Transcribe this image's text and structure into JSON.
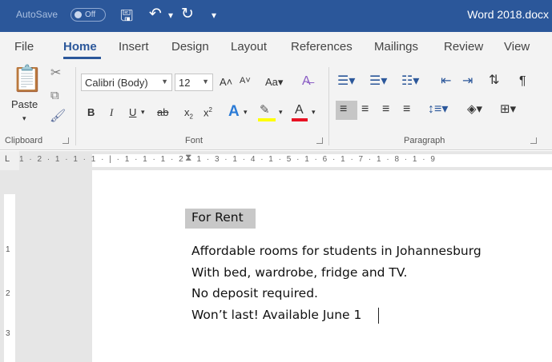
{
  "titlebar": {
    "autosave_label": "AutoSave",
    "autosave_state": "Off",
    "document_title": "Word 2018.docx"
  },
  "tabs": [
    {
      "label": "File"
    },
    {
      "label": "Home",
      "active": true
    },
    {
      "label": "Insert"
    },
    {
      "label": "Design"
    },
    {
      "label": "Layout"
    },
    {
      "label": "References"
    },
    {
      "label": "Mailings"
    },
    {
      "label": "Review"
    },
    {
      "label": "View"
    }
  ],
  "ribbon": {
    "clipboard": {
      "paste_label": "Paste",
      "group_label": "Clipboard"
    },
    "font": {
      "font_name": "Calibri (Body)",
      "font_size": "12",
      "group_label": "Font",
      "highlight_color": "#ffff00",
      "font_color": "#e81123"
    },
    "paragraph": {
      "group_label": "Paragraph"
    }
  },
  "ruler": {
    "marks": "1 · 2 · 1 · 1 · 1 · | · 1 · 1 · 1 · 2 · 1 · 3 · 1 · 4 · 1 · 5 · 1 · 6 · 1 · 7 · 1 · 8 · 1 · 9",
    "vertical_marks": [
      "1",
      "2",
      "3"
    ]
  },
  "document": {
    "heading": "For Rent",
    "lines": [
      "Affordable rooms for students in Johannesburg",
      "With bed, wardrobe, fridge and TV.",
      "No deposit required.",
      "Won’t last! Available June 1"
    ]
  },
  "colors": {
    "accent": "#2b579a",
    "ribbon_bg": "#f3f3f3",
    "selection_gray": "#c8c8c8"
  }
}
